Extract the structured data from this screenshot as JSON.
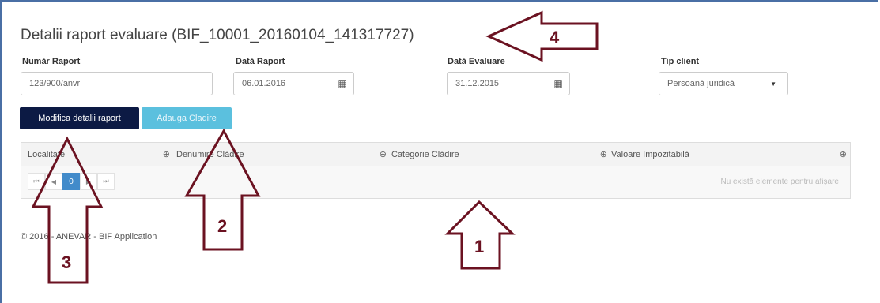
{
  "page": {
    "title": "Detalii raport evaluare (BIF_10001_20160104_141317727)"
  },
  "form": {
    "numar_raport": {
      "label": "Număr Raport",
      "value": "123/900/anvr"
    },
    "data_raport": {
      "label": "Dată Raport",
      "value": "06.01.2016",
      "icon": "calendar-icon"
    },
    "data_evaluare": {
      "label": "Dată Evaluare",
      "value": "31.12.2015",
      "icon": "calendar-icon"
    },
    "tip_client": {
      "label": "Tip client",
      "value": "Persoană juridică"
    }
  },
  "buttons": {
    "modifica": "Modifica detalii raport",
    "adauga": "Adauga Cladire"
  },
  "grid": {
    "columns": [
      "Localitate",
      "Denumire Clădire",
      "Categorie Clădire",
      "Valoare Impozitabilă"
    ],
    "pager": {
      "first": "⏮",
      "prev": "◀",
      "page": "0",
      "next": "▶",
      "last": "⏭"
    },
    "empty_message": "Nu există elemente pentru afișare"
  },
  "footer": "© 2016 - ANEVAR - BIF Application",
  "annotations": [
    "1",
    "2",
    "3",
    "4"
  ],
  "colors": {
    "annotation": "#6b1221",
    "primary_button": "#0c1a44",
    "info_button": "#5bc0de"
  }
}
